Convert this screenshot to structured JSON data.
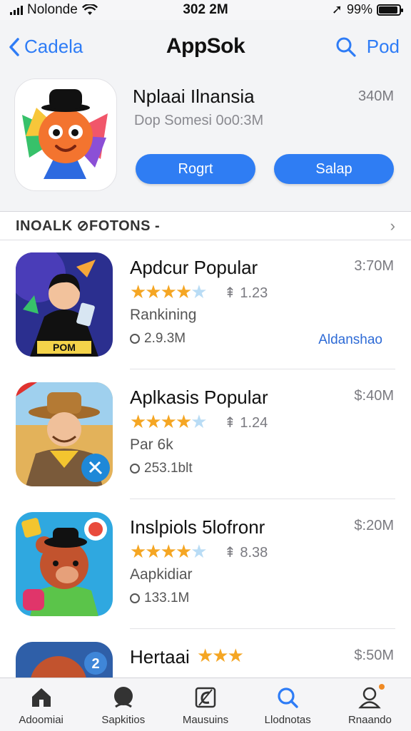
{
  "status": {
    "carrier": "Nolonde",
    "time": "302 2M",
    "battery": "99%"
  },
  "nav": {
    "back_label": "Cadela",
    "title": "AppSok",
    "right_label": "Pod"
  },
  "featured": {
    "title": "Nplaai Ilnansia",
    "size": "340M",
    "subtitle": "Dop Somesi  0o0:3M",
    "get_label": "Rogrt",
    "setup_label": "Salap"
  },
  "section": {
    "title": "INOALK ⊘FOTONS -",
    "more": "›"
  },
  "apps": [
    {
      "name": "Apdcur Popular",
      "price": "3:70M",
      "stars": "★★★★",
      "rating": "⇞ 1.23",
      "category": "Rankining",
      "downloads": "2.9.3M",
      "link": "Aldanshao",
      "thumb_color": "#2b2f8f"
    },
    {
      "name": "Aplkasis Popular",
      "price": "$:40M",
      "stars": "★★★★",
      "rating": "⇞ 1.24",
      "category": "Par 6k",
      "downloads": "253.1blt",
      "link": "",
      "thumb_color": "#e3b25a"
    },
    {
      "name": "Inslpiols 5lofronr",
      "price": "$:20M",
      "stars": "★★★★",
      "rating": "⇞ 8.38",
      "category": "Aapkidiar",
      "downloads": "133.1M",
      "link": "",
      "thumb_color": "#2fa8e0"
    }
  ],
  "partial_app": {
    "name": "Hertaai",
    "stars": "★★★",
    "price": "$:50M"
  },
  "tabs": [
    {
      "label": "Adoomiai",
      "icon": "home-icon"
    },
    {
      "label": "Sapkitios",
      "icon": "profile-circle-icon"
    },
    {
      "label": "Mausuins",
      "icon": "apps-icon"
    },
    {
      "label": "Llodnotas",
      "icon": "search-icon"
    },
    {
      "label": "Rnaando",
      "icon": "person-icon"
    }
  ],
  "colors": {
    "accent": "#2f7df3",
    "star": "#f5a623"
  }
}
